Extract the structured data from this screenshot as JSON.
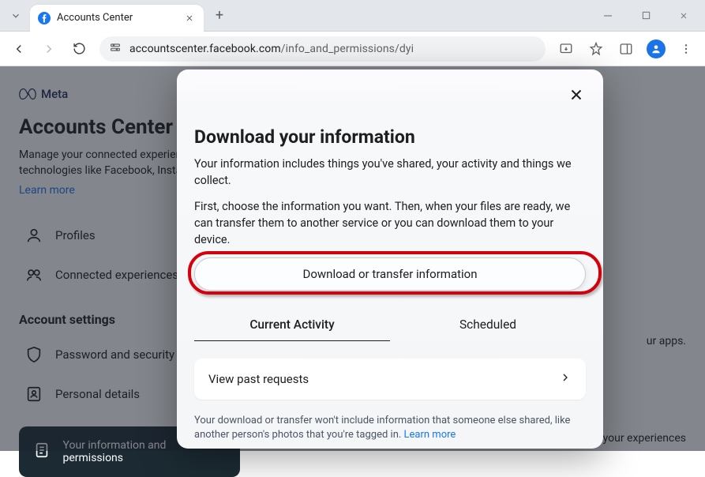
{
  "browser": {
    "tab_title": "Accounts Center",
    "url_host": "accountscenter.facebook.com",
    "url_path": "/info_and_permissions/dyi"
  },
  "page": {
    "brand": "Meta",
    "title": "Accounts Center",
    "description": "Manage your connected experiences and account settings across Meta technologies like Facebook, Instagram and more.",
    "learn_more": "Learn more",
    "sidebar": {
      "items": [
        {
          "label": "Profiles"
        },
        {
          "label": "Connected experiences"
        }
      ],
      "heading": "Account settings",
      "settings": [
        {
          "label": "Password and security"
        },
        {
          "label": "Personal details"
        }
      ]
    },
    "banner_text": "Your information and permissions",
    "right_fragment_1": "ur apps.",
    "right_fragment_2": "nce your experiences"
  },
  "modal": {
    "title": "Download your information",
    "para1": "Your information includes things you've shared, your activity and things we collect.",
    "para2": "First, choose the information you want. Then, when your files are ready, we can transfer them to another service or you can download them to your device.",
    "primary_button": "Download or transfer information",
    "tabs": {
      "active": "Current Activity",
      "other": "Scheduled"
    },
    "past_requests": "View past requests",
    "footer": "Your download or transfer won't include information that someone else shared, like another person's photos that you're tagged in. ",
    "footer_link": "Learn more"
  }
}
